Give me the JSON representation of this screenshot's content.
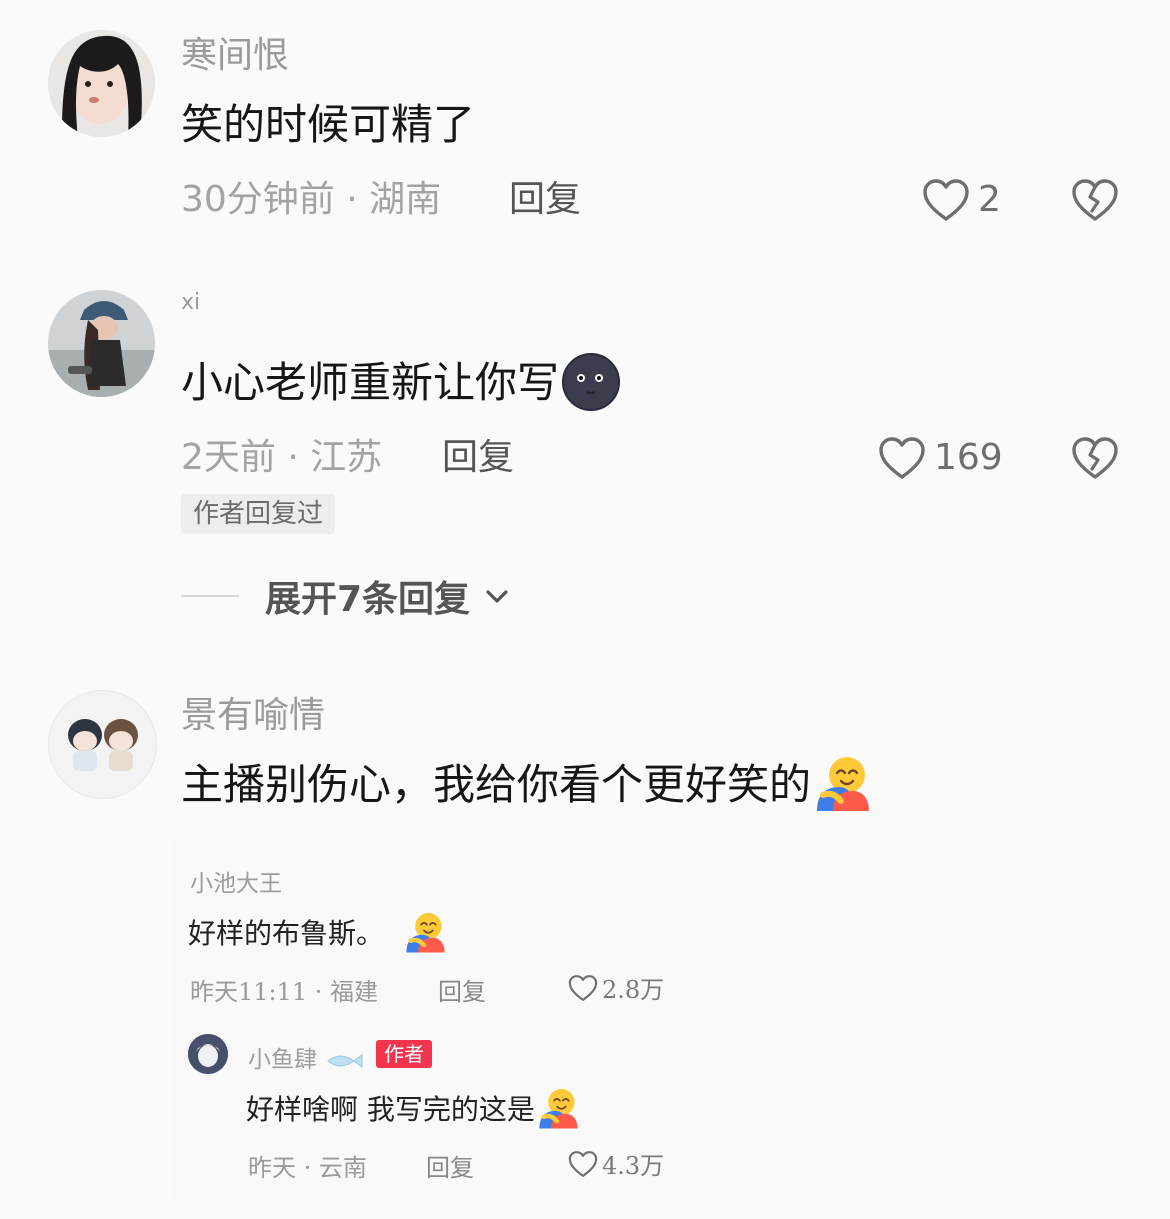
{
  "comments": [
    {
      "username": "寒间恨",
      "text": "笑的时候可精了",
      "meta": "30分钟前 · 湖南",
      "reply": "回复",
      "likes": "2",
      "avatar_icon": "person-photo"
    },
    {
      "username": "xi",
      "text": "小心老师重新让你写",
      "emoji": "new-moon-face",
      "meta": "2天前 · 江苏",
      "reply": "回复",
      "likes": "169",
      "tag": "作者回复过",
      "expand": "展开7条回复",
      "avatar_icon": "person-photo"
    },
    {
      "username": "景有喻情",
      "text": "主播别伤心，我给你看个更好笑的",
      "emoji": "hugging-face",
      "avatar_icon": "cartoon-pair"
    }
  ],
  "screenshot": {
    "comment": {
      "username": "小池大王",
      "text": "好样的布鲁斯。",
      "meta": "昨天11:11 · 福建",
      "reply": "回复",
      "likes": "2.8万"
    },
    "reply": {
      "username": "小鱼肆",
      "author_tag": "作者",
      "text": "好样啥啊 我写完的这是",
      "meta": "昨天 · 云南",
      "reply": "回复",
      "likes": "4.3万"
    }
  },
  "colors": {
    "accent_red": "#f2344f",
    "muted": "#a3a3a3",
    "text": "#161616"
  }
}
